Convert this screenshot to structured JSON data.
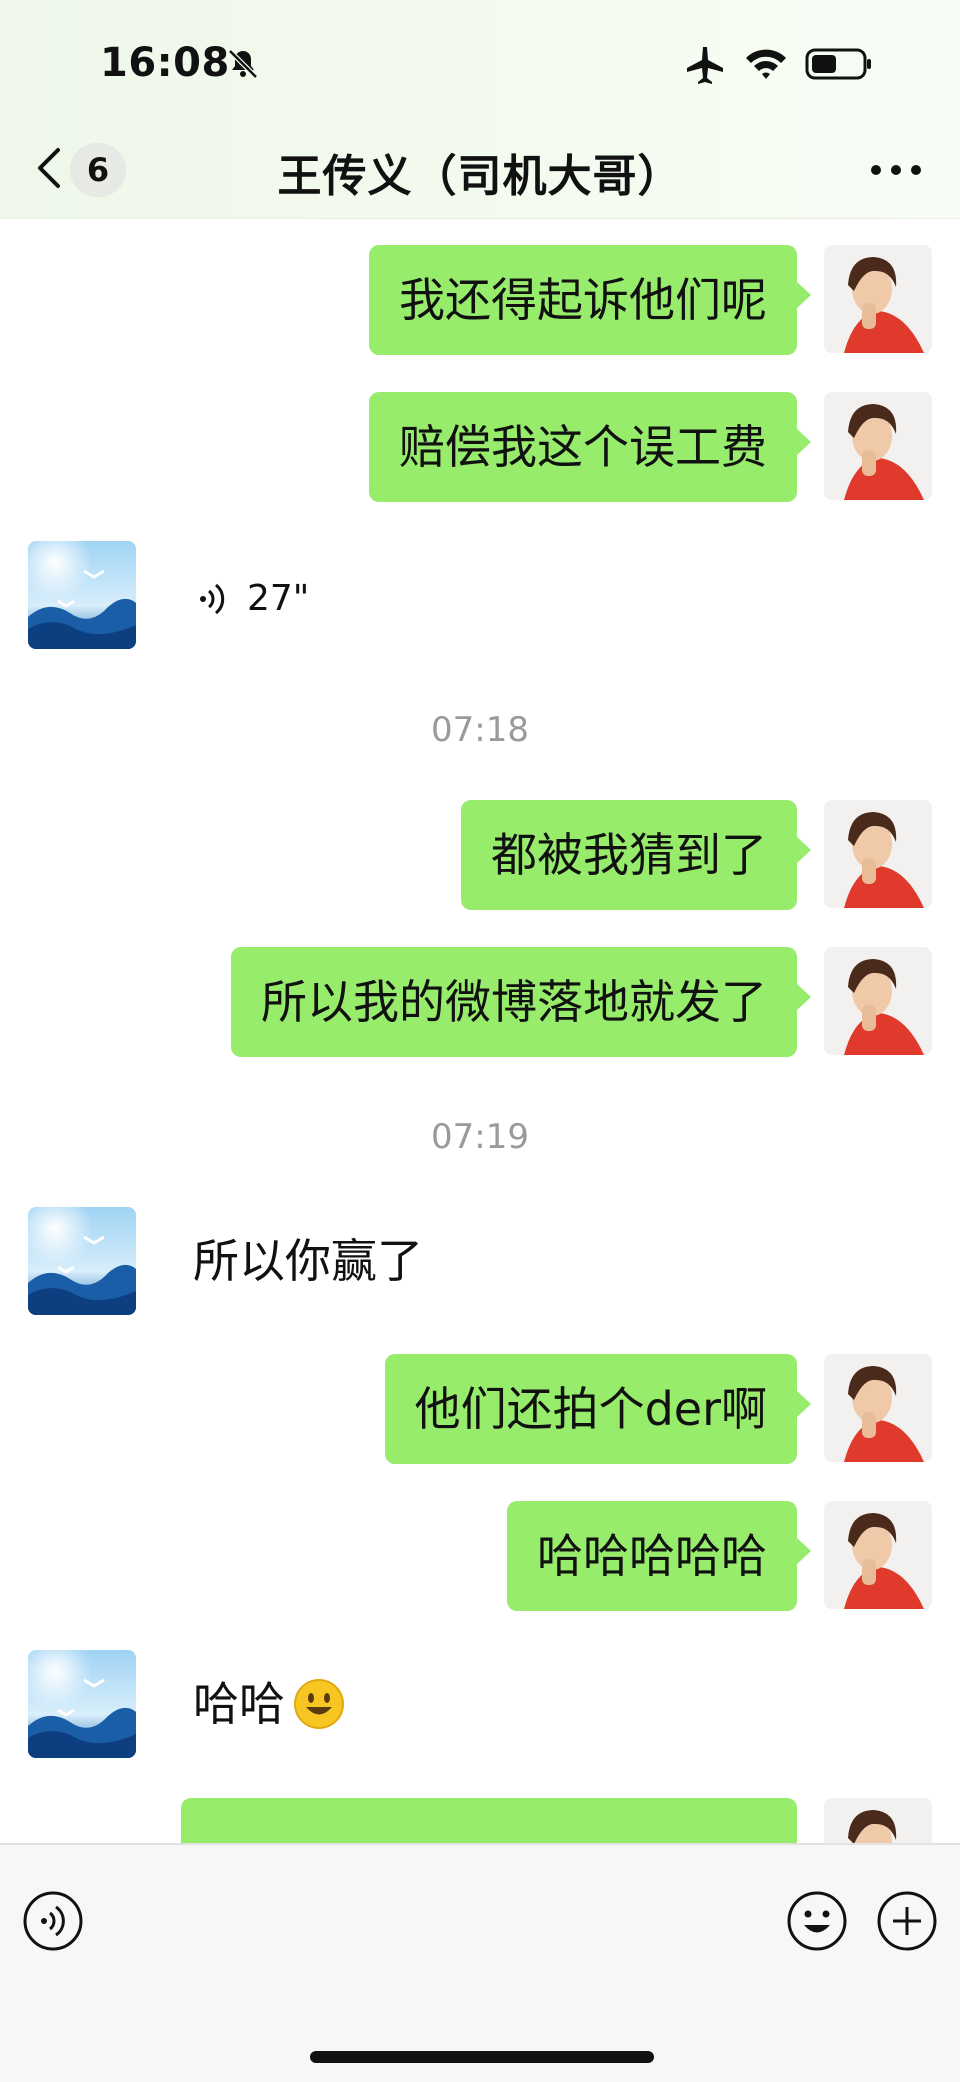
{
  "status_bar": {
    "time": "16:08"
  },
  "header": {
    "unread_count": "6",
    "title": "王传义（司机大哥）"
  },
  "messages": [
    {
      "side": "out",
      "text": "我还得起诉他们呢"
    },
    {
      "side": "out",
      "text": "赔偿我这个误工费"
    },
    {
      "side": "in",
      "type": "voice",
      "duration": "27\""
    },
    {
      "type": "timestamp",
      "text": "07:18"
    },
    {
      "side": "out",
      "text": "都被我猜到了"
    },
    {
      "side": "out",
      "text": "所以我的微博落地就发了"
    },
    {
      "type": "timestamp",
      "text": "07:19"
    },
    {
      "side": "in",
      "text": "所以你赢了"
    },
    {
      "side": "out",
      "text": "他们还拍个der啊"
    },
    {
      "side": "out",
      "text": "哈哈哈哈哈"
    },
    {
      "side": "in",
      "text": "哈哈"
    }
  ],
  "colors": {
    "outgoing_bubble": "#97ec6b",
    "timestamp_text": "#9a9a9a"
  }
}
